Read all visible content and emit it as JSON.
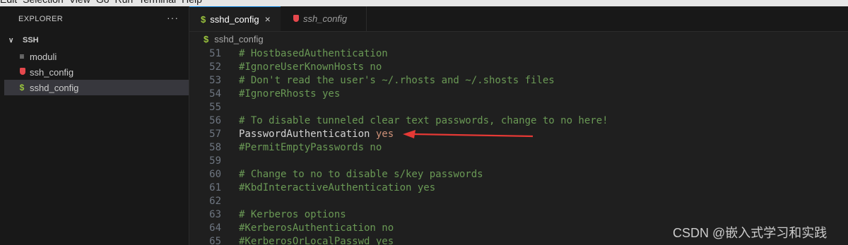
{
  "menubar": {
    "items": [
      "Edit",
      "Selection",
      "View",
      "Go",
      "Run",
      "Terminal",
      "Help"
    ]
  },
  "sidebar": {
    "header": "EXPLORER",
    "more": "···",
    "folder": {
      "chevron": "∨",
      "name": "SSH"
    },
    "files": [
      {
        "name": "moduli",
        "icon": "lines-icon"
      },
      {
        "name": "ssh_config",
        "icon": "red-file-icon"
      },
      {
        "name": "sshd_config",
        "icon": "dollar-icon",
        "selected": true
      }
    ]
  },
  "tabs": [
    {
      "label": "sshd_config",
      "icon": "dollar-icon",
      "active": true,
      "close": "×"
    },
    {
      "label": "ssh_config",
      "icon": "red-file-icon",
      "active": false
    }
  ],
  "breadcrumb": {
    "file": "sshd_config"
  },
  "editor": {
    "lines": [
      {
        "n": "51",
        "parts": [
          {
            "t": "# HostbasedAuthentication",
            "c": "comment"
          }
        ]
      },
      {
        "n": "52",
        "parts": [
          {
            "t": "#IgnoreUserKnownHosts no",
            "c": "comment"
          }
        ]
      },
      {
        "n": "53",
        "parts": [
          {
            "t": "# Don't read the user's ~/.rhosts and ~/.shosts files",
            "c": "comment"
          }
        ]
      },
      {
        "n": "54",
        "parts": [
          {
            "t": "#IgnoreRhosts yes",
            "c": "comment"
          }
        ]
      },
      {
        "n": "55",
        "parts": []
      },
      {
        "n": "56",
        "parts": [
          {
            "t": "# To disable tunneled clear text passwords, change to no here!",
            "c": "comment"
          }
        ]
      },
      {
        "n": "57",
        "parts": [
          {
            "t": "PasswordAuthentication ",
            "c": "key"
          },
          {
            "t": "yes",
            "c": "val"
          }
        ]
      },
      {
        "n": "58",
        "parts": [
          {
            "t": "#PermitEmptyPasswords no",
            "c": "comment"
          }
        ]
      },
      {
        "n": "59",
        "parts": []
      },
      {
        "n": "60",
        "parts": [
          {
            "t": "# Change to no to disable s/key passwords",
            "c": "comment"
          }
        ]
      },
      {
        "n": "61",
        "parts": [
          {
            "t": "#KbdInteractiveAuthentication yes",
            "c": "comment"
          }
        ]
      },
      {
        "n": "62",
        "parts": []
      },
      {
        "n": "63",
        "parts": [
          {
            "t": "# Kerberos options",
            "c": "comment"
          }
        ]
      },
      {
        "n": "64",
        "parts": [
          {
            "t": "#KerberosAuthentication no",
            "c": "comment"
          }
        ]
      },
      {
        "n": "65",
        "parts": [
          {
            "t": "#KerberosOrLocalPasswd yes",
            "c": "comment"
          }
        ]
      }
    ]
  },
  "annotation": {
    "color": "#e53935"
  },
  "watermark": "CSDN @嵌入式学习和实践"
}
